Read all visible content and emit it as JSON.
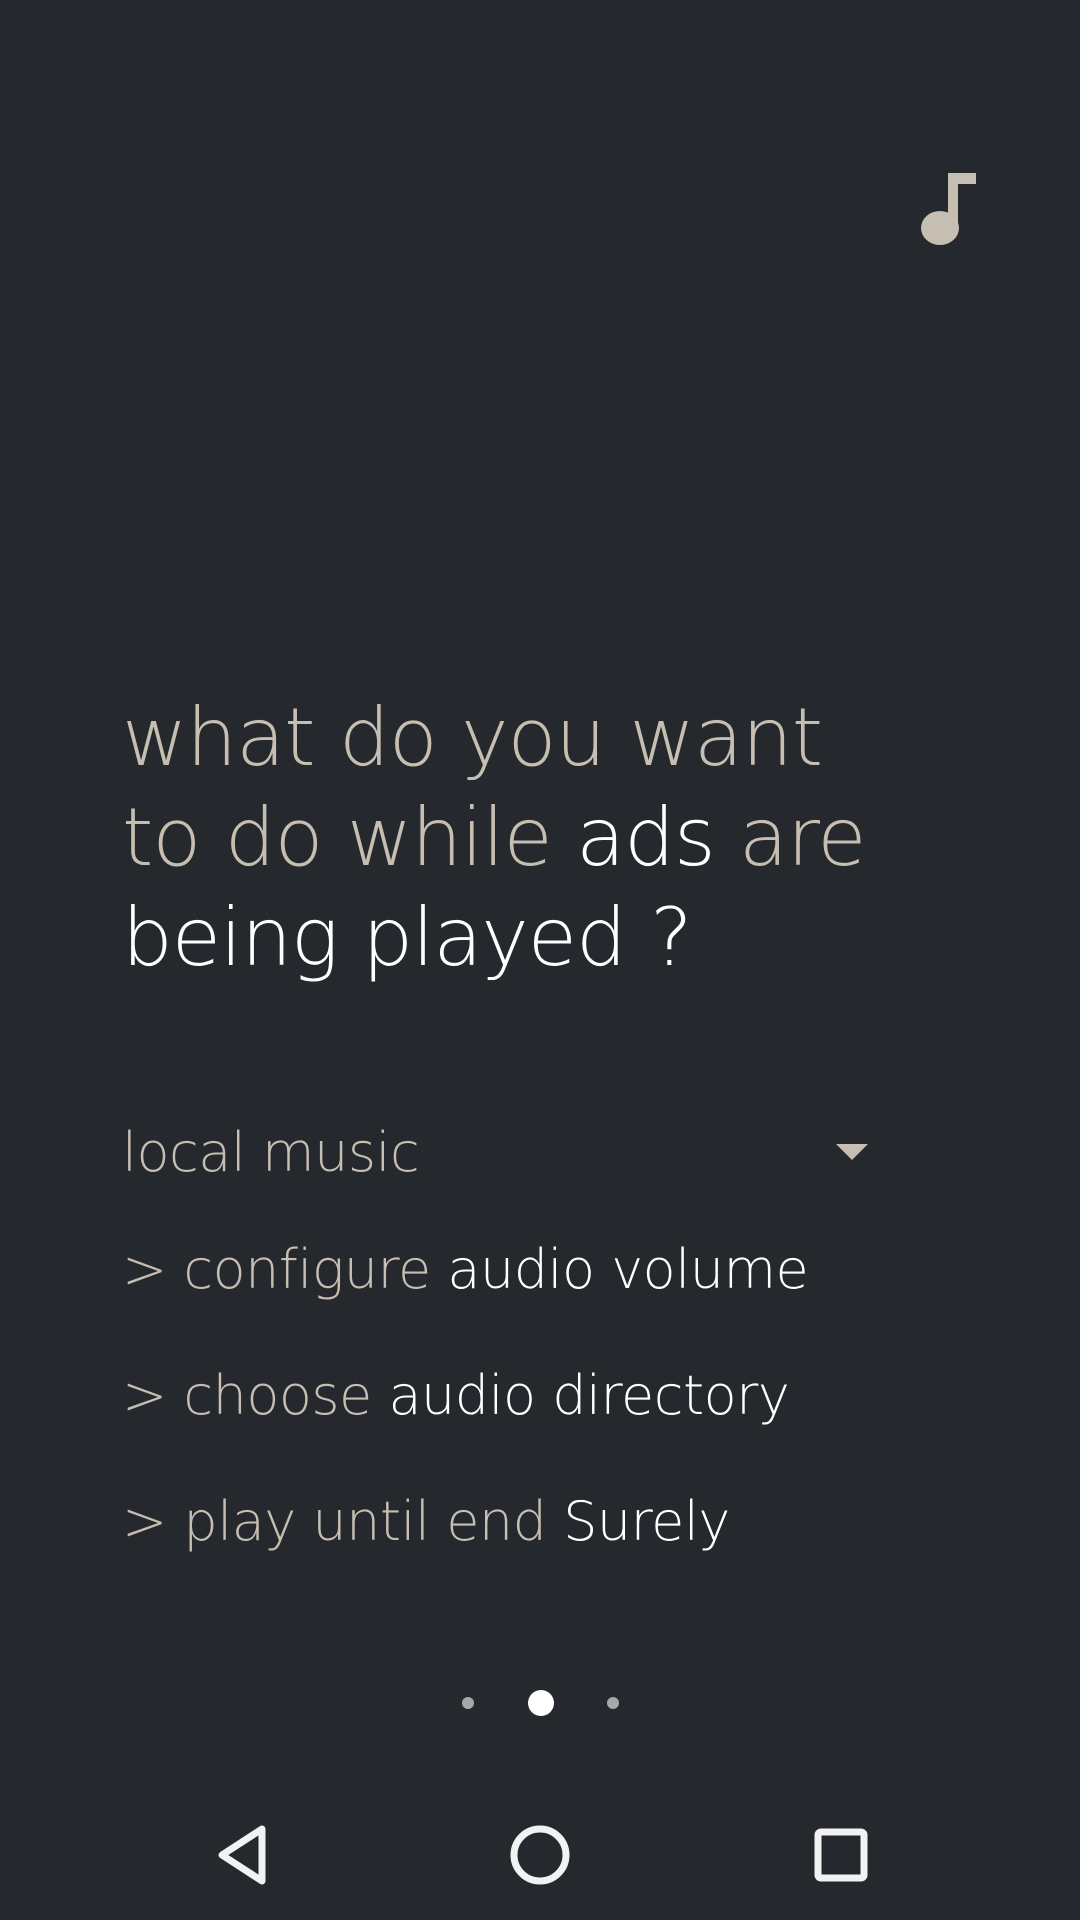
{
  "header": {
    "icon": "music-note-icon"
  },
  "headline": {
    "line1": "what do you want",
    "line2_a": "to do while ",
    "line2_b": "ads",
    "line2_c": " are",
    "line3": "being played ?"
  },
  "dropdown": {
    "selected": "local music",
    "arrow_icon": "dropdown-arrow-icon"
  },
  "options": [
    {
      "prefix": "> configure ",
      "value": "audio volume"
    },
    {
      "prefix": "> choose ",
      "value": "audio directory"
    },
    {
      "prefix": "> play until end  ",
      "value": "Surely"
    }
  ],
  "pager": {
    "page_count": 3,
    "active_page": 2
  },
  "navbar": {
    "back_icon": "back-triangle-icon",
    "home_icon": "home-circle-icon",
    "recents_icon": "recents-square-icon"
  },
  "colors": {
    "background": "#25292d",
    "muted_text": "#c7beb2",
    "bright_text": "#ffffff"
  }
}
